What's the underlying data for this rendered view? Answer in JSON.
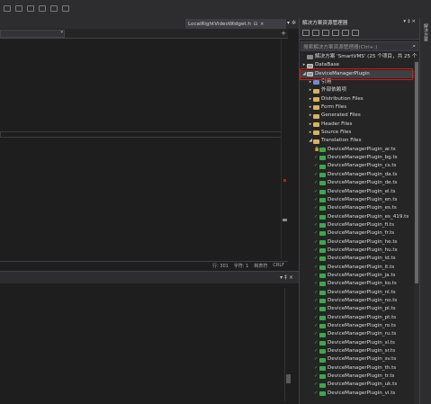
{
  "toolbar": {
    "icons": [
      "undo-icon",
      "redo-icon",
      "bookmark-icon",
      "bookmark-prev-icon",
      "bookmark-next-icon",
      "bookmark-clear-icon"
    ]
  },
  "editor": {
    "tab_title": "LocalRightVideoWidget.h",
    "tab_pin": "⊟",
    "tab_close": "×",
    "tab_menu": "▾ ✲",
    "nav_arrow": "▾",
    "nav_add": "+",
    "status": {
      "line": "行: 301",
      "char": "字符: 1",
      "tabs": "制表符",
      "eol": "CRLF"
    }
  },
  "bottom_panel": {
    "controls": "▾ ‡ ×"
  },
  "solution_explorer": {
    "title": "解决方案资源管理器",
    "controls": "▾ ‡ ×",
    "search_placeholder": "搜索解决方案资源管理器(Ctrl+;)",
    "search_icon": "⌕",
    "right_tab": "解决方案",
    "tree": [
      {
        "label": "解决方案 'SmartVMS' (25 个项目，共 25 个",
        "arrow": "",
        "icon": "solution",
        "indent": 0
      },
      {
        "label": "DataBase",
        "arrow": "▸",
        "icon": "project",
        "indent": 0
      },
      {
        "label": "DeviceManagerPlugin",
        "arrow": "◢",
        "icon": "project",
        "indent": 0,
        "selected": true
      },
      {
        "label": "引用",
        "arrow": "▸",
        "icon": "ref",
        "indent": 1
      },
      {
        "label": "外部依赖项",
        "arrow": "▸",
        "icon": "folder",
        "indent": 1
      },
      {
        "label": "Distribution Files",
        "arrow": "▸",
        "icon": "folder",
        "indent": 1
      },
      {
        "label": "Form Files",
        "arrow": "▸",
        "icon": "folder",
        "indent": 1
      },
      {
        "label": "Generated Files",
        "arrow": "▸",
        "icon": "folder",
        "indent": 1
      },
      {
        "label": "Header Files",
        "arrow": "▸",
        "icon": "folder",
        "indent": 1
      },
      {
        "label": "Source Files",
        "arrow": "▸",
        "icon": "folder",
        "indent": 1
      },
      {
        "label": "Translation Files",
        "arrow": "◢",
        "icon": "folder",
        "indent": 1
      },
      {
        "label": "DeviceManagerPlugin_ar.ts",
        "icon": "ts",
        "indent": 2,
        "mark": "lock"
      },
      {
        "label": "DeviceManagerPlugin_bg.ts",
        "icon": "ts",
        "indent": 2,
        "mark": "check"
      },
      {
        "label": "DeviceManagerPlugin_cs.ts",
        "icon": "ts",
        "indent": 2,
        "mark": "check"
      },
      {
        "label": "DeviceManagerPlugin_da.ts",
        "icon": "ts",
        "indent": 2,
        "mark": "check"
      },
      {
        "label": "DeviceManagerPlugin_de.ts",
        "icon": "ts",
        "indent": 2,
        "mark": "check"
      },
      {
        "label": "DeviceManagerPlugin_el.ts",
        "icon": "ts",
        "indent": 2,
        "mark": "check"
      },
      {
        "label": "DeviceManagerPlugin_en.ts",
        "icon": "ts",
        "indent": 2,
        "mark": "check"
      },
      {
        "label": "DeviceManagerPlugin_es.ts",
        "icon": "ts",
        "indent": 2,
        "mark": "check"
      },
      {
        "label": "DeviceManagerPlugin_es_419.ts",
        "icon": "ts",
        "indent": 2,
        "mark": "check"
      },
      {
        "label": "DeviceManagerPlugin_fi.ts",
        "icon": "ts",
        "indent": 2,
        "mark": "check"
      },
      {
        "label": "DeviceManagerPlugin_fr.ts",
        "icon": "ts",
        "indent": 2,
        "mark": "check"
      },
      {
        "label": "DeviceManagerPlugin_he.ts",
        "icon": "ts",
        "indent": 2,
        "mark": "check"
      },
      {
        "label": "DeviceManagerPlugin_hu.ts",
        "icon": "ts",
        "indent": 2,
        "mark": "check"
      },
      {
        "label": "DeviceManagerPlugin_id.ts",
        "icon": "ts",
        "indent": 2,
        "mark": "check"
      },
      {
        "label": "DeviceManagerPlugin_it.ts",
        "icon": "ts",
        "indent": 2,
        "mark": "check"
      },
      {
        "label": "DeviceManagerPlugin_ja.ts",
        "icon": "ts",
        "indent": 2,
        "mark": "check"
      },
      {
        "label": "DeviceManagerPlugin_ko.ts",
        "icon": "ts",
        "indent": 2,
        "mark": "check"
      },
      {
        "label": "DeviceManagerPlugin_nl.ts",
        "icon": "ts",
        "indent": 2,
        "mark": "check"
      },
      {
        "label": "DeviceManagerPlugin_no.ts",
        "icon": "ts",
        "indent": 2,
        "mark": "check"
      },
      {
        "label": "DeviceManagerPlugin_pl.ts",
        "icon": "ts",
        "indent": 2,
        "mark": "check"
      },
      {
        "label": "DeviceManagerPlugin_pt.ts",
        "icon": "ts",
        "indent": 2,
        "mark": "check"
      },
      {
        "label": "DeviceManagerPlugin_ro.ts",
        "icon": "ts",
        "indent": 2,
        "mark": "check"
      },
      {
        "label": "DeviceManagerPlugin_ru.ts",
        "icon": "ts",
        "indent": 2,
        "mark": "check"
      },
      {
        "label": "DeviceManagerPlugin_sl.ts",
        "icon": "ts",
        "indent": 2,
        "mark": "check"
      },
      {
        "label": "DeviceManagerPlugin_sr.ts",
        "icon": "ts",
        "indent": 2,
        "mark": "check"
      },
      {
        "label": "DeviceManagerPlugin_sv.ts",
        "icon": "ts",
        "indent": 2,
        "mark": "check"
      },
      {
        "label": "DeviceManagerPlugin_th.ts",
        "icon": "ts",
        "indent": 2,
        "mark": "check"
      },
      {
        "label": "DeviceManagerPlugin_tr.ts",
        "icon": "ts",
        "indent": 2,
        "mark": "check"
      },
      {
        "label": "DeviceManagerPlugin_uk.ts",
        "icon": "ts",
        "indent": 2,
        "mark": "check"
      },
      {
        "label": "DeviceManagerPlugin_vi.ts",
        "icon": "ts",
        "indent": 2,
        "mark": "check"
      }
    ]
  },
  "colors": {
    "background": "#1e1e1e",
    "panel": "#252526",
    "chrome": "#2d2d30",
    "selection_border": "#e51400",
    "ts_icon": "#3ea64b",
    "folder_icon": "#d9b25c"
  }
}
